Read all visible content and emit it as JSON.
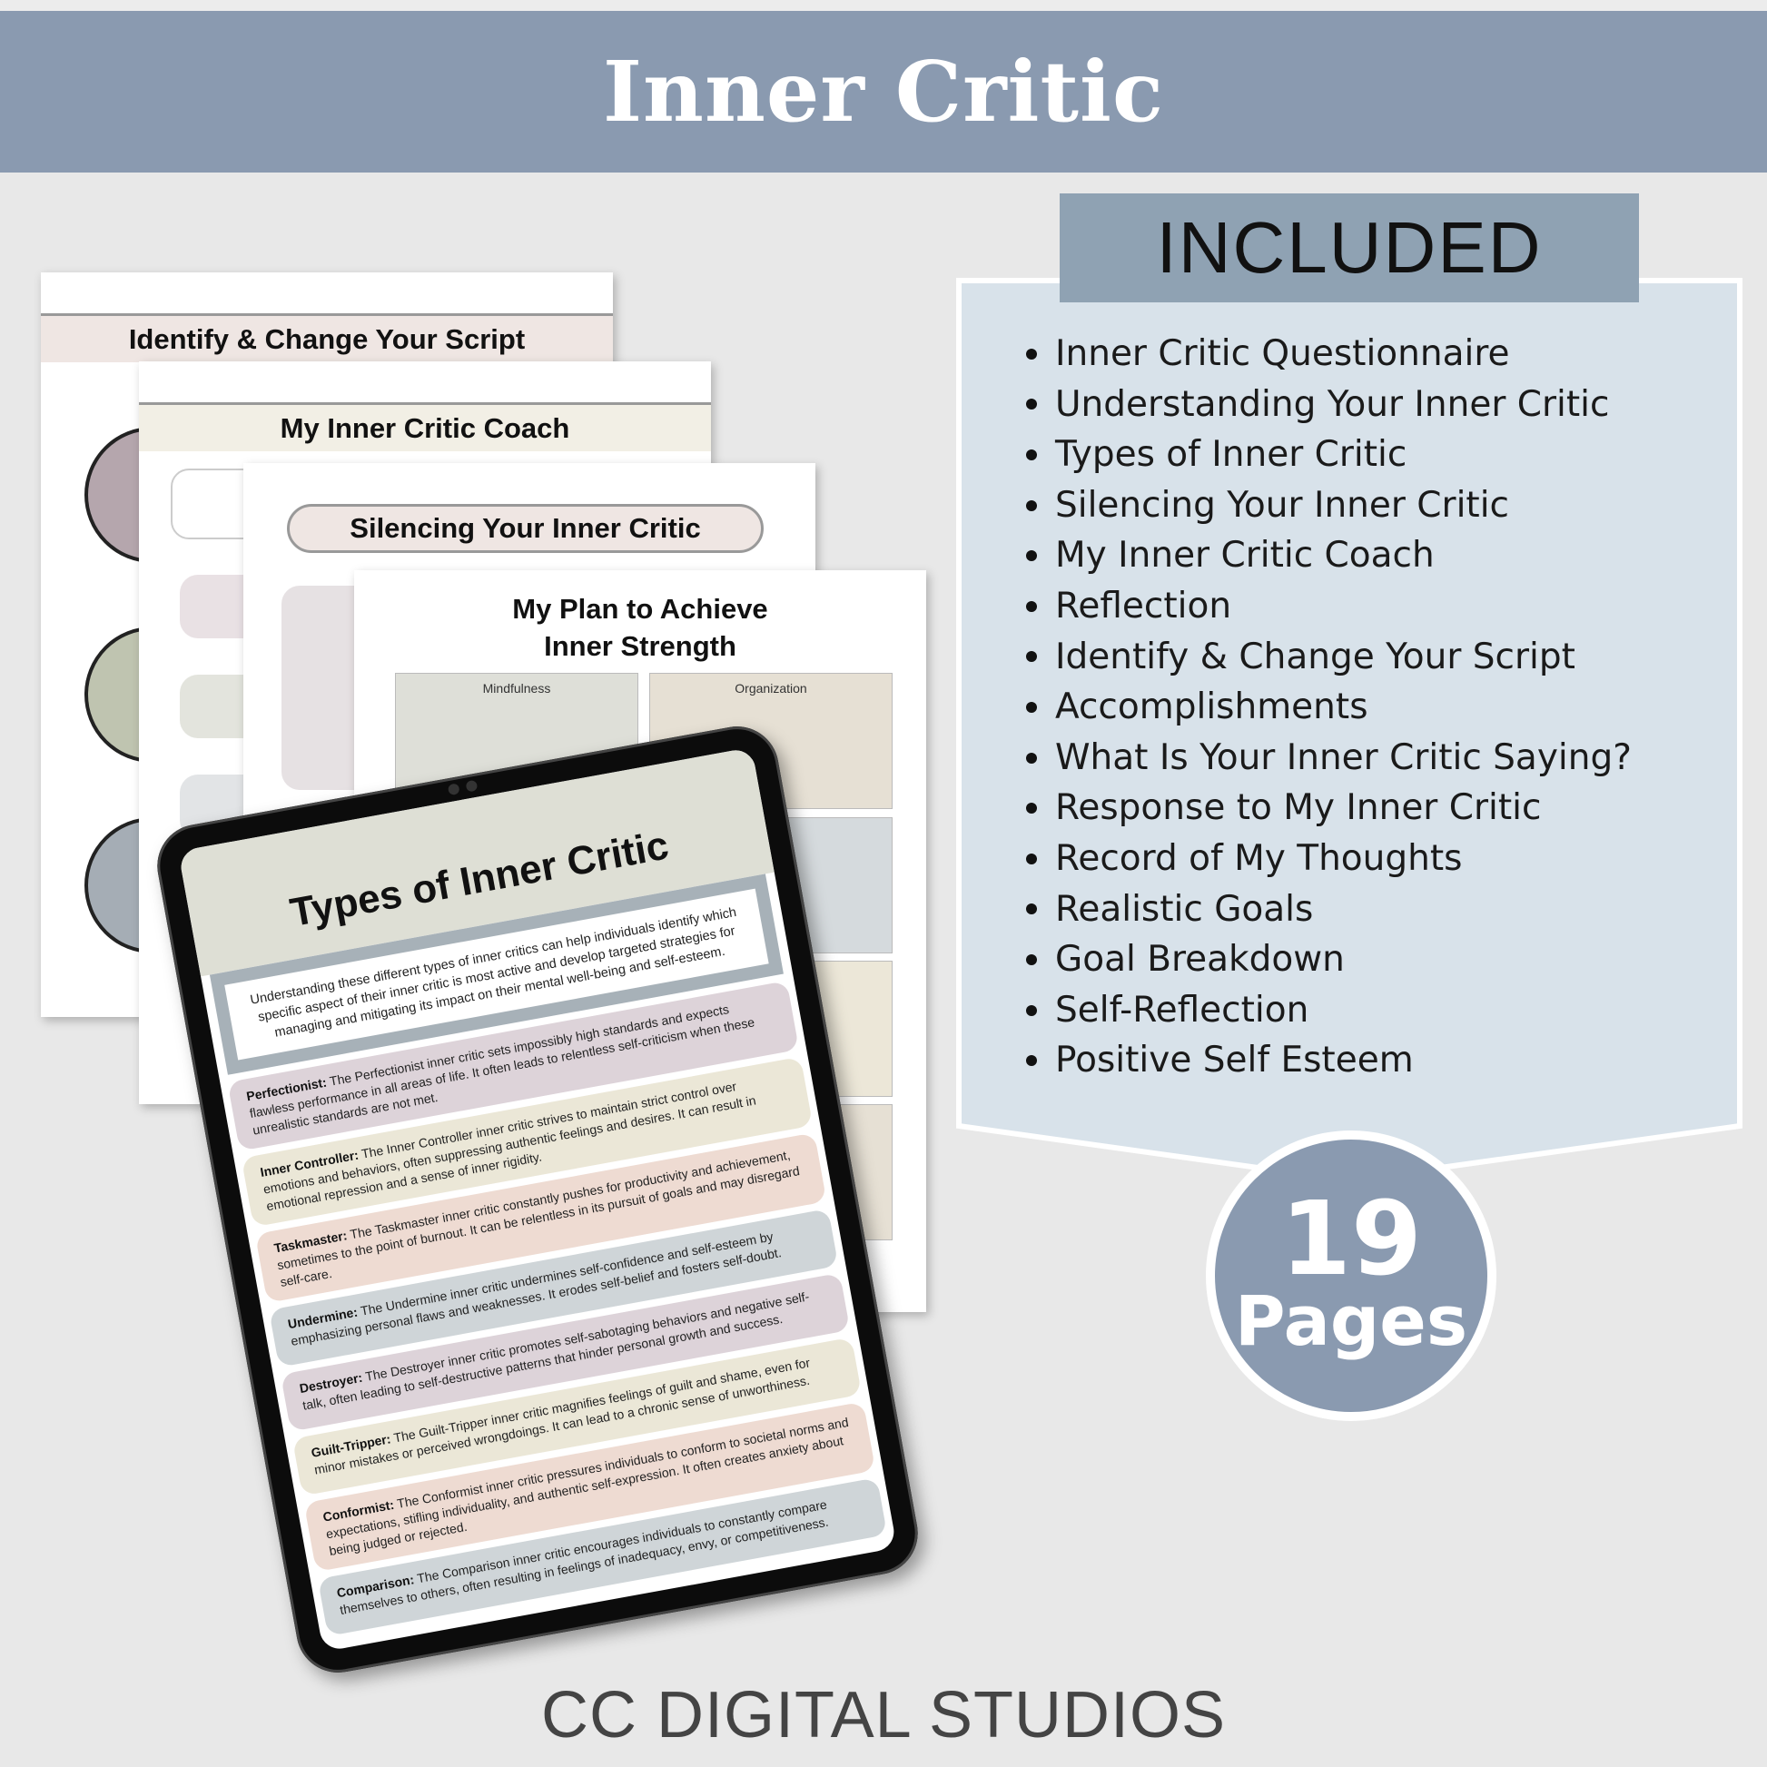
{
  "header": {
    "title": "Inner Critic"
  },
  "pages": {
    "script_title": "Identify & Change Your Script",
    "coach_title": "My Inner Critic Coach",
    "silencing_title": "Silencing Your Inner Critic",
    "plan_title_1": "My Plan to Achieve",
    "plan_title_2": "Inner Strength",
    "plan_boxes": [
      "Mindfulness",
      "Organization"
    ]
  },
  "included": {
    "label": "INCLUDED",
    "items": [
      "Inner Critic Questionnaire",
      "Understanding Your Inner Critic",
      "Types of Inner Critic",
      "Silencing Your Inner Critic",
      "My Inner Critic Coach",
      "Reflection",
      "Identify & Change Your Script",
      "Accomplishments",
      "What Is Your Inner Critic Saying?",
      "Response to My Inner Critic",
      "Record of My Thoughts",
      "Realistic Goals",
      "Goal Breakdown",
      "Self-Reflection",
      "Positive Self Esteem"
    ]
  },
  "badge": {
    "count": "19",
    "unit": "Pages",
    "color": "#8a9ab0"
  },
  "tablet": {
    "title": "Types of Inner Critic",
    "intro": "Understanding these different types of inner critics can help individuals identify which specific aspect of their inner critic is most active and develop targeted strategies for managing and mitigating its impact on their mental well-being and self-esteem.",
    "cards": [
      {
        "name": "Perfectionist:",
        "text": "The Perfectionist inner critic sets impossibly high standards and expects flawless performance in all areas of life. It often leads to relentless self-criticism when these unrealistic standards are not met.",
        "color": "#ddd3d9"
      },
      {
        "name": "Inner Controller:",
        "text": "The Inner Controller inner critic strives to maintain strict control over emotions and behaviors, often suppressing authentic feelings and desires. It can result in emotional repression and a sense of inner rigidity.",
        "color": "#ebe7d7"
      },
      {
        "name": "Taskmaster:",
        "text": "The Taskmaster inner critic constantly pushes for productivity and achievement, sometimes to the point of burnout. It can be relentless in its pursuit of goals and may disregard self-care.",
        "color": "#eedbd2"
      },
      {
        "name": "Undermine:",
        "text": "The Undermine inner critic undermines self-confidence and self-esteem by emphasizing personal flaws and weaknesses. It erodes self-belief and fosters self-doubt.",
        "color": "#cfd5d8"
      },
      {
        "name": "Destroyer:",
        "text": "The Destroyer inner critic promotes self-sabotaging behaviors and negative self-talk, often leading to self-destructive patterns that hinder personal growth and success.",
        "color": "#ddd3d9"
      },
      {
        "name": "Guilt-Tripper:",
        "text": "The Guilt-Tripper inner critic magnifies feelings of guilt and shame, even for minor mistakes or perceived wrongdoings. It can lead to a chronic sense of unworthiness.",
        "color": "#ebe7d7"
      },
      {
        "name": "Conformist:",
        "text": "The Conformist inner critic pressures individuals to conform to societal norms and expectations, stifling individuality, and authentic self-expression. It often creates anxiety about being judged or rejected.",
        "color": "#eedbd2"
      },
      {
        "name": "Comparison:",
        "text": "The Comparison inner critic encourages individuals to constantly compare themselves to others, often resulting in feelings of inadequacy, envy, or competitiveness.",
        "color": "#cfd5d8"
      }
    ]
  },
  "footer": {
    "brand": "CC DIGITAL STUDIOS"
  }
}
